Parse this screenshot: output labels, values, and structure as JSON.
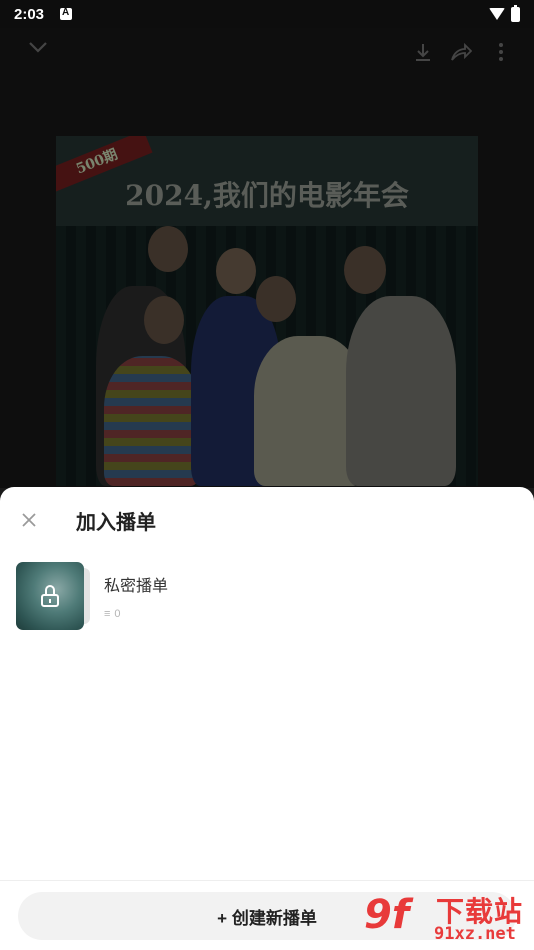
{
  "status_bar": {
    "time": "2:03"
  },
  "player": {
    "icons": [
      "chevron-down-icon",
      "download-icon",
      "share-icon",
      "more-icon"
    ],
    "cover": {
      "title": "2024,我们的电影年会",
      "ribbon": "500期"
    }
  },
  "sheet": {
    "title": "加入播单",
    "playlists": [
      {
        "name": "私密播单",
        "count": "0",
        "locked": true
      }
    ],
    "create_label": "+ 创建新播单"
  },
  "watermark": {
    "logo": "9f",
    "text": "下载站",
    "url": "91xz.net"
  }
}
